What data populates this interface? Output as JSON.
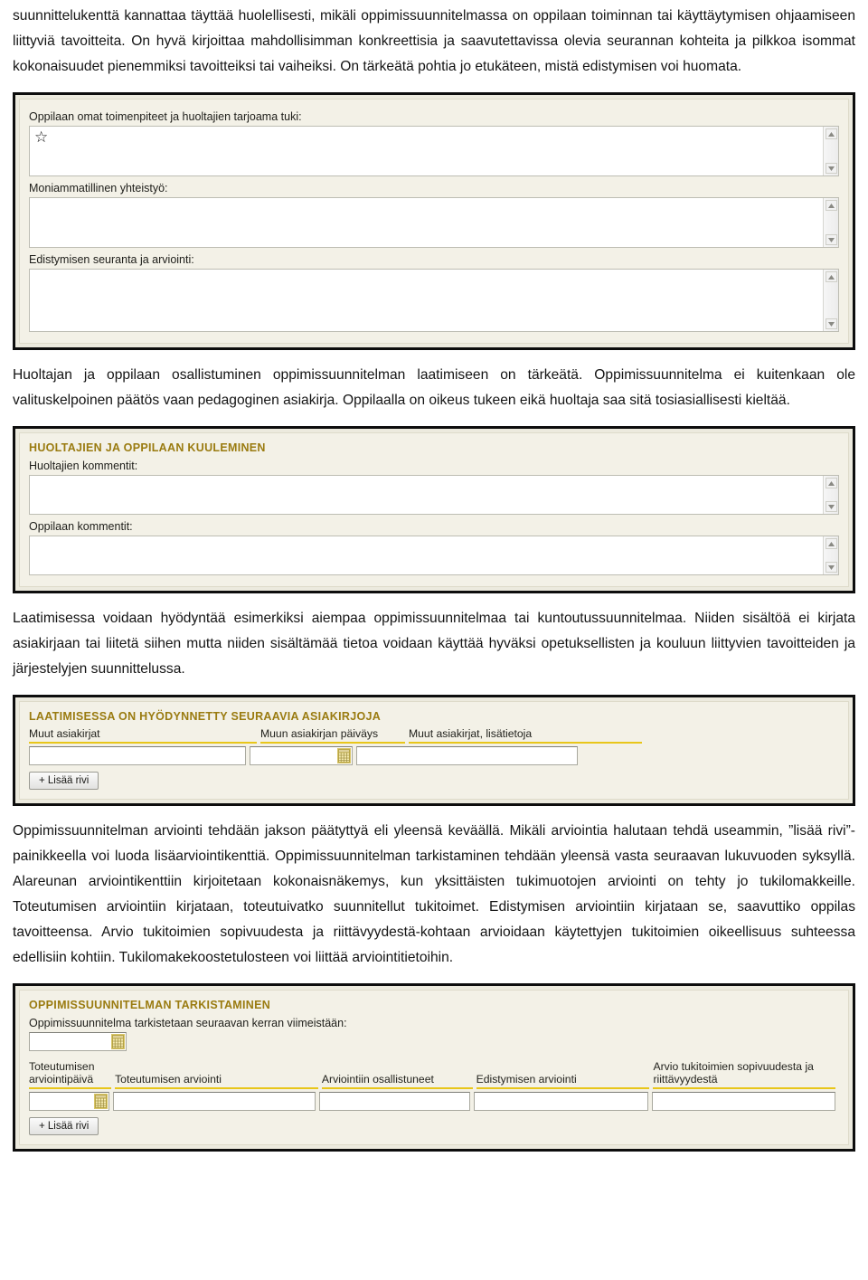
{
  "document": {
    "paragraphs": {
      "p1": "suunnittelukenttä kannattaa täyttää huolellisesti, mikäli oppimissuunnitelmassa on oppilaan toiminnan tai käyttäytymisen ohjaamiseen liittyviä tavoitteita. On hyvä kirjoittaa mahdollisimman konkreettisia ja saavutettavissa olevia seurannan kohteita ja pilkkoa isommat kokonaisuudet pienemmiksi tavoitteiksi tai vaiheiksi. On tärkeätä pohtia jo etukäteen, mistä edistymisen voi huomata.",
      "p2": "Huoltajan ja oppilaan osallistuminen oppimissuunnitelman laatimiseen on tärkeätä. Oppimissuunnitelma ei kuitenkaan ole valituskelpoinen päätös vaan pedagoginen asiakirja. Oppilaalla on oikeus tukeen eikä huoltaja saa sitä tosiasiallisesti kieltää.",
      "p3": "Laatimisessa voidaan hyödyntää esimerkiksi aiempaa oppimissuunnitelmaa tai kuntoutussuunnitelmaa. Niiden sisältöä ei kirjata asiakirjaan tai liitetä siihen mutta niiden sisältämää tietoa voidaan käyttää hyväksi opetuksellisten ja kouluun liittyvien tavoitteiden ja järjestelyjen suunnittelussa.",
      "p4": "Oppimissuunnitelman arviointi tehdään jakson päätyttyä eli yleensä keväällä. Mikäli arviointia halutaan tehdä useammin, ”lisää rivi”-painikkeella voi luoda lisäarviointikenttiä. Oppimissuunnitelman tarkistaminen tehdään yleensä vasta seuraavan lukuvuoden syksyllä. Alareunan arviointikenttiin kirjoitetaan kokonaisnäkemys, kun yksittäisten tukimuotojen arviointi on tehty jo tukilomakkeille. Toteutumisen arviointiin kirjataan, toteutuivatko suunnitellut tukitoimet. Edistymisen arviointiin kirjataan se, saavuttiko oppilas tavoitteensa. Arvio tukitoimien sopivuudesta ja riittävyydestä-kohtaan arvioidaan käytettyjen tukitoimien oikeellisuus suhteessa edellisiin kohtiin. Tukilomakekoostetulosteen voi liittää arviointitietoihin."
    }
  },
  "form_one": {
    "fields": [
      {
        "label": "Oppilaan omat toimenpiteet ja huoltajien tarjoama tuki:",
        "value": "☆",
        "icon": "star-outline-icon"
      },
      {
        "label": "Moniammatillinen yhteistyö:",
        "value": ""
      },
      {
        "label": "Edistymisen seuranta ja arviointi:",
        "value": ""
      }
    ]
  },
  "form_two": {
    "title": "HUOLTAJIEN JA OPPILAAN KUULEMINEN",
    "fields": [
      {
        "label": "Huoltajien kommentit:",
        "value": ""
      },
      {
        "label": "Oppilaan kommentit:",
        "value": ""
      }
    ]
  },
  "form_three": {
    "title": "LAATIMISESSA ON HYÖDYNNETTY SEURAAVIA ASIAKIRJOJA",
    "columns": [
      {
        "header": "Muut asiakirjat",
        "type": "text",
        "value": ""
      },
      {
        "header": "Muun asiakirjan päiväys",
        "type": "date",
        "value": "",
        "icon": "calendar-icon"
      },
      {
        "header": "Muut asiakirjat, lisätietoja",
        "type": "text",
        "value": ""
      }
    ],
    "add_row_label": "+ Lisää rivi"
  },
  "form_four": {
    "title": "OPPIMISSUUNNITELMAN TARKISTAMINEN",
    "date_label": "Oppimissuunnitelma tarkistetaan seuraavan kerran viimeistään:",
    "date_value": "",
    "date_icon": "calendar-icon",
    "columns": [
      {
        "header": "Toteutumisen arviointipäivä",
        "type": "date",
        "value": "",
        "icon": "calendar-icon"
      },
      {
        "header": "Toteutumisen arviointi",
        "type": "text",
        "value": ""
      },
      {
        "header": "Arviointiin osallistuneet",
        "type": "text",
        "value": ""
      },
      {
        "header": "Edistymisen arviointi",
        "type": "text",
        "value": ""
      },
      {
        "header": "Arvio tukitoimien sopivuudesta ja riittävyydestä",
        "type": "text",
        "value": ""
      }
    ],
    "add_row_label": "+ Lisää rivi"
  },
  "colors": {
    "section_title": "#9a7b10",
    "accent_underline": "#e8c61a",
    "shot_border": "#0d0d0d",
    "shot_background": "#f3f1e7",
    "calendar_icon": "#f3e08a"
  }
}
